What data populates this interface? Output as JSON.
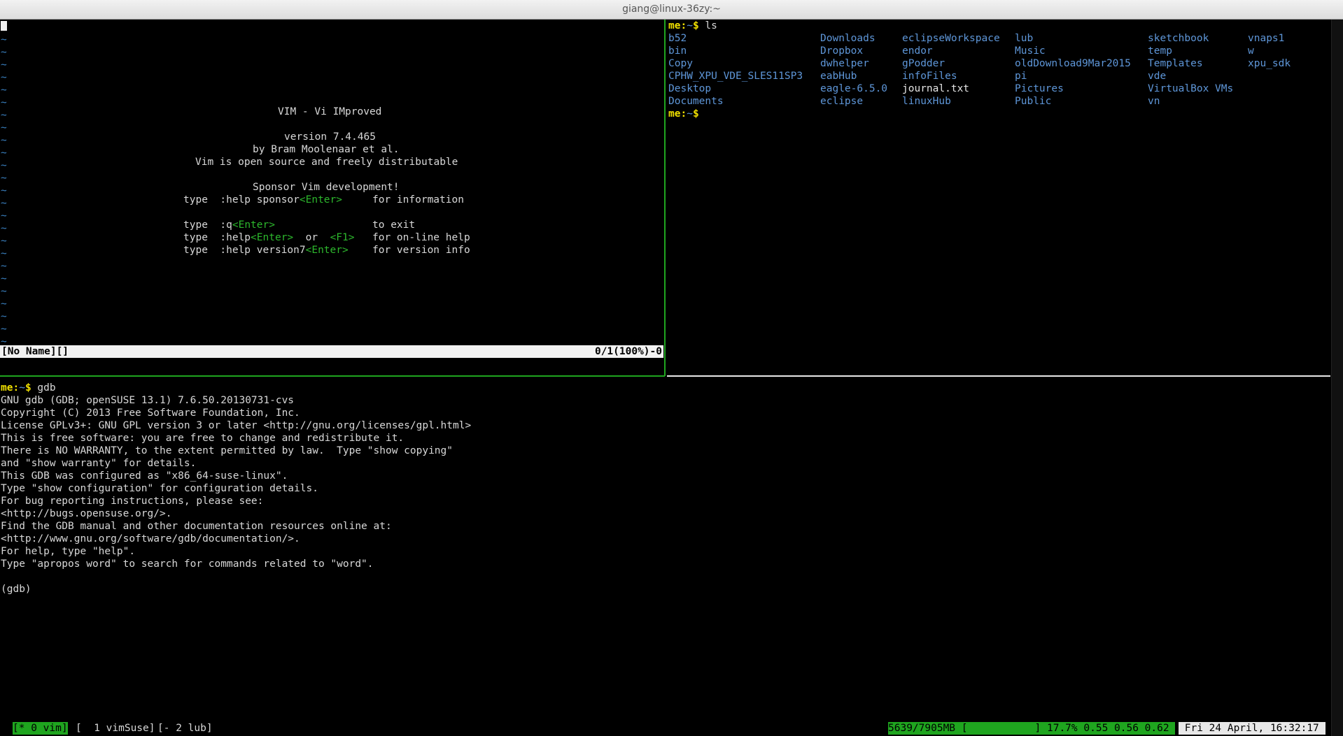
{
  "window": {
    "title": "giang@linux-36zy:~"
  },
  "vim": {
    "intro": {
      "title": "VIM - Vi IMproved",
      "version": "version 7.4.465",
      "author": "by Bram Moolenaar et al.",
      "license": "Vim is open source and freely distributable",
      "sponsor": "Sponsor Vim development!",
      "type_word": "type",
      "l1_cmd": ":help sponsor",
      "l1_key": "<Enter>",
      "l1_desc": "for information",
      "l2_cmd": ":q",
      "l2_key": "<Enter>",
      "l2_desc": "to exit",
      "l3_cmd": ":help",
      "l3_key": "<Enter>",
      "l3_or": "or",
      "l3_key2": "<F1>",
      "l3_desc": "for on-line help",
      "l4_cmd": ":help version7",
      "l4_key": "<Enter>",
      "l4_desc": "for version info"
    },
    "tilde": "~",
    "status_left": "[No Name][]",
    "status_right": "0/1(100%)-0"
  },
  "shell_top": {
    "prompt_user": "me:",
    "prompt_path": "~",
    "prompt_sym": "$",
    "command": "ls",
    "columns": [
      [
        "b52",
        "bin",
        "Copy",
        "CPHW_XPU_VDE_SLES11SP3",
        "Desktop",
        "Documents"
      ],
      [
        "Downloads",
        "Dropbox",
        "dwhelper",
        "eabHub",
        "eagle-6.5.0",
        "eclipse"
      ],
      [
        "eclipseWorkspace",
        "endor",
        "gPodder",
        "infoFiles",
        "journal.txt",
        "linuxHub"
      ],
      [
        "lub",
        "Music",
        "oldDownload9Mar2015",
        "pi",
        "Pictures",
        "Public"
      ],
      [
        "sketchbook",
        "temp",
        "Templates",
        "vde",
        "VirtualBox VMs",
        "vn"
      ],
      [
        "vnaps1",
        "w",
        "xpu_sdk"
      ]
    ],
    "plain_files": [
      "journal.txt"
    ]
  },
  "gdb": {
    "prompt_user": "me:",
    "prompt_path": "~",
    "prompt_sym": "$",
    "command": "gdb",
    "output": [
      "GNU gdb (GDB; openSUSE 13.1) 7.6.50.20130731-cvs",
      "Copyright (C) 2013 Free Software Foundation, Inc.",
      "License GPLv3+: GNU GPL version 3 or later <http://gnu.org/licenses/gpl.html>",
      "This is free software: you are free to change and redistribute it.",
      "There is NO WARRANTY, to the extent permitted by law.  Type \"show copying\"",
      "and \"show warranty\" for details.",
      "This GDB was configured as \"x86_64-suse-linux\".",
      "Type \"show configuration\" for configuration details.",
      "For bug reporting instructions, please see:",
      "<http://bugs.opensuse.org/>.",
      "Find the GDB manual and other documentation resources online at:",
      "<http://www.gnu.org/software/gdb/documentation/>.",
      "For help, type \"help\".",
      "Type \"apropos word\" to search for commands related to \"word\".",
      "",
      "(gdb)"
    ]
  },
  "tmux": {
    "windows": [
      "[* 0 vim]",
      "[  1 vimSuse]",
      "[- 2 lub]"
    ],
    "mem": "5639/7905MB [",
    "mem_bar": "           ",
    "mem_end": "]",
    "load": " 17.7% 0.55 0.56 0.62 ",
    "clock": " Fri 24 April, 16:32:17 ",
    "colors": {
      "active": "#1fa51f",
      "clock_bg": "#e8e8e8"
    }
  }
}
